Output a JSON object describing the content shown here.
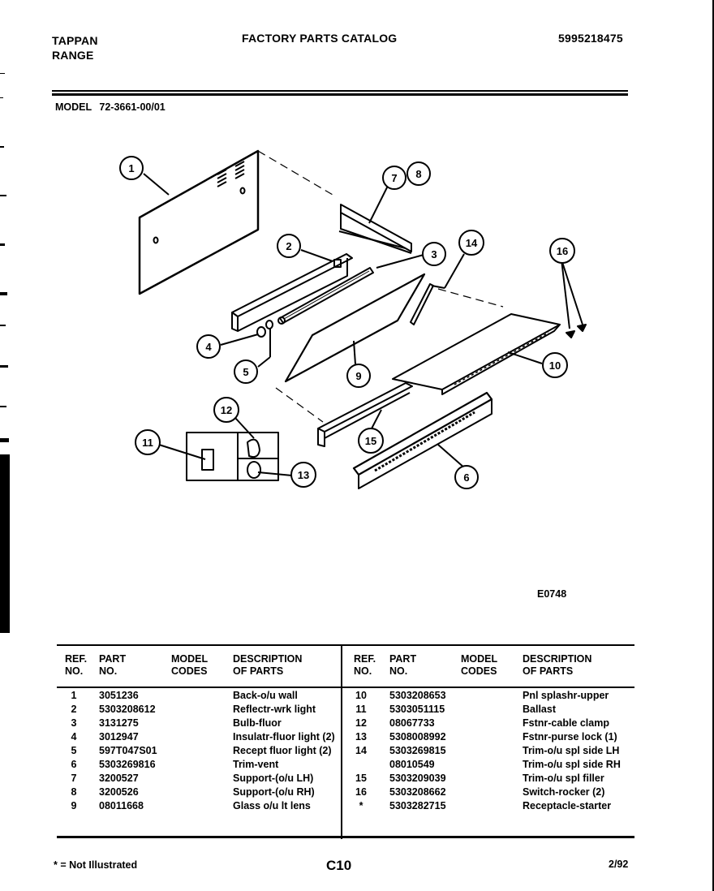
{
  "header": {
    "brand_line1": "TAPPAN",
    "brand_line2": "RANGE",
    "title": "FACTORY PARTS CATALOG",
    "catalog_number": "5995218475",
    "model_label": "MODEL",
    "model_number": "72-3661-00/01"
  },
  "diagram": {
    "figure_code": "E0748",
    "callouts": [
      "1",
      "2",
      "3",
      "4",
      "5",
      "6",
      "7",
      "8",
      "9",
      "10",
      "11",
      "12",
      "13",
      "14",
      "15",
      "16"
    ]
  },
  "table": {
    "headers": {
      "ref_line1": "REF.",
      "ref_line2": "NO.",
      "part_line1": "PART",
      "part_line2": "NO.",
      "model_line1": "MODEL",
      "model_line2": "CODES",
      "desc_line1": "DESCRIPTION",
      "desc_line2": "OF PARTS"
    },
    "left_rows": [
      {
        "ref": "1",
        "part": "3051236",
        "codes": "",
        "desc": "Back-o/u wall"
      },
      {
        "ref": "2",
        "part": "5303208612",
        "codes": "",
        "desc": "Reflectr-wrk light"
      },
      {
        "ref": "3",
        "part": "3131275",
        "codes": "",
        "desc": "Bulb-fluor"
      },
      {
        "ref": "4",
        "part": "3012947",
        "codes": "",
        "desc": "Insulatr-fluor light (2)"
      },
      {
        "ref": "5",
        "part": "597T047S01",
        "codes": "",
        "desc": "Recept fluor light (2)"
      },
      {
        "ref": "6",
        "part": "5303269816",
        "codes": "",
        "desc": "Trim-vent"
      },
      {
        "ref": "7",
        "part": "3200527",
        "codes": "",
        "desc": "Support-(o/u LH)"
      },
      {
        "ref": "8",
        "part": "3200526",
        "codes": "",
        "desc": "Support-(o/u RH)"
      },
      {
        "ref": "9",
        "part": "08011668",
        "codes": "",
        "desc": "Glass o/u lt lens"
      }
    ],
    "right_rows": [
      {
        "ref": "10",
        "part": "5303208653",
        "codes": "",
        "desc": "Pnl splashr-upper"
      },
      {
        "ref": "11",
        "part": "5303051115",
        "codes": "",
        "desc": "Ballast"
      },
      {
        "ref": "12",
        "part": "08067733",
        "codes": "",
        "desc": "Fstnr-cable clamp"
      },
      {
        "ref": "13",
        "part": "5308008992",
        "codes": "",
        "desc": "Fstnr-purse lock (1)"
      },
      {
        "ref": "14",
        "part": "5303269815",
        "codes": "",
        "desc": "Trim-o/u spl side LH"
      },
      {
        "ref": "",
        "part": "08010549",
        "codes": "",
        "desc": "Trim-o/u spl side RH"
      },
      {
        "ref": "15",
        "part": "5303209039",
        "codes": "",
        "desc": "Trim-o/u spl filler"
      },
      {
        "ref": "16",
        "part": "5303208662",
        "codes": "",
        "desc": "Switch-rocker (2)"
      },
      {
        "ref": "*",
        "part": "5303282715",
        "codes": "",
        "desc": "Receptacle-starter"
      }
    ]
  },
  "footer": {
    "note": "* = Not Illustrated",
    "page": "C10",
    "date": "2/92"
  }
}
